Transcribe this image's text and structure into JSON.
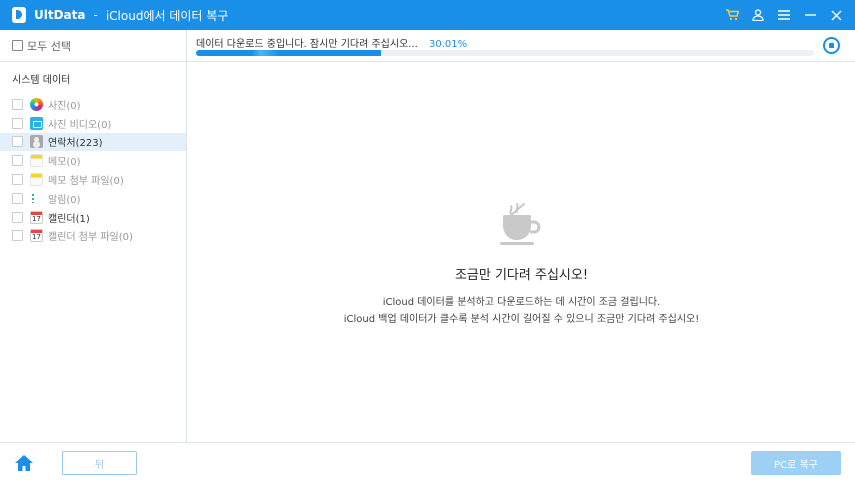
{
  "titlebar": {
    "app_name": "UltData",
    "separator": "-",
    "subtitle": "iCloud에서 데이터 복구",
    "icons": [
      "cart-icon",
      "user-icon",
      "menu-icon",
      "minimize-icon",
      "close-icon"
    ],
    "accent": "#1a8fe8",
    "cart_color": "#f7c948"
  },
  "sidebar": {
    "select_all": "모두 선택",
    "section": "시스템 데이터",
    "items": [
      {
        "label": "사진(0)",
        "icon": "photos-icon"
      },
      {
        "label": "사진 비디오(0)",
        "icon": "video-icon"
      },
      {
        "label": "연락처(223)",
        "icon": "contacts-icon"
      },
      {
        "label": "메모(0)",
        "icon": "notes-icon"
      },
      {
        "label": "메모 첨부 파일(0)",
        "icon": "notes-attachment-icon"
      },
      {
        "label": "알림(0)",
        "icon": "reminders-icon"
      },
      {
        "label": "캘린더(1)",
        "icon": "calendar-icon"
      },
      {
        "label": "캘린더 첨부 파일(0)",
        "icon": "calendar-attachment-icon"
      }
    ]
  },
  "progress": {
    "message": "데이터 다운로드 중입니다. 잠시만 기다려 주십시오...",
    "percent_text": "30.01%",
    "fraction": 0.3001
  },
  "main": {
    "title": "조금만 기다려 주십시오!",
    "desc_line1": "iCloud 데이터를 분석하고 다운로드하는 데 시간이 조금 걸립니다.",
    "desc_line2": "iCloud 백업 데이터가 클수록 분석 시간이 길어질 수 있으니 조금만 기다려 주십시오!"
  },
  "footer": {
    "back_label": "뒤",
    "restore_label": "PC로 복구"
  }
}
